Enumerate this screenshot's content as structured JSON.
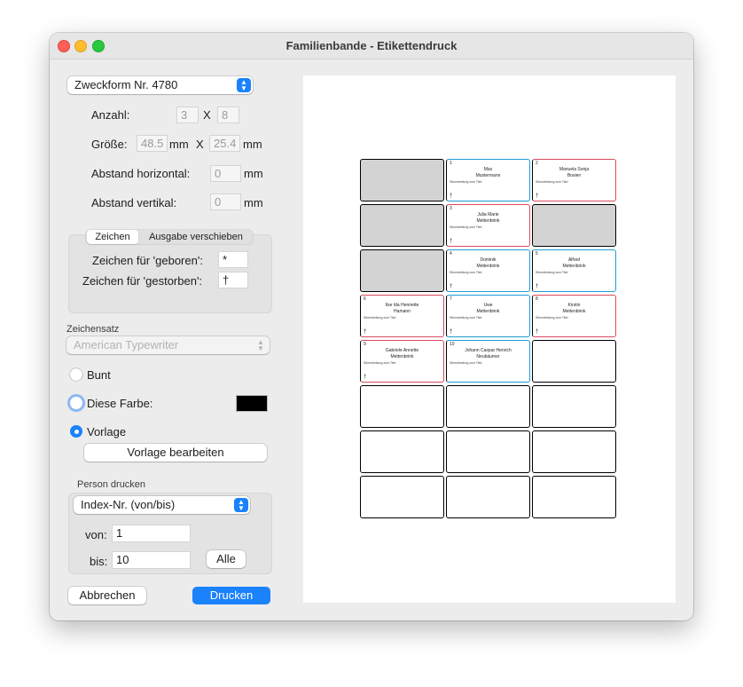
{
  "window": {
    "title": "Familienbande - Etikettendruck"
  },
  "format": {
    "selected": "Zweckform Nr. 4780"
  },
  "anzahl": {
    "label": "Anzahl:",
    "cols": "3",
    "x": "X",
    "rows": "8"
  },
  "groesse": {
    "label": "Größe:",
    "width": "48.5",
    "unit1": "mm",
    "x": "X",
    "height": "25.4",
    "unit2": "mm"
  },
  "abstand_h": {
    "label": "Abstand horizontal:",
    "value": "0",
    "unit": "mm"
  },
  "abstand_v": {
    "label": "Abstand vertikal:",
    "value": "0",
    "unit": "mm"
  },
  "tabs": {
    "zeichen": "Zeichen",
    "ausgabe": "Ausgabe verschieben"
  },
  "zeichen": {
    "geboren_label": "Zeichen für 'geboren':",
    "geboren_value": "*",
    "gestorben_label": "Zeichen für 'gestorben':",
    "gestorben_value": "†"
  },
  "zeichensatz": {
    "label": "Zeichensatz",
    "value": "American Typewriter"
  },
  "color": {
    "bunt": "Bunt",
    "diese_farbe": "Diese Farbe:",
    "vorlage": "Vorlage",
    "swatch": "#000000"
  },
  "vorlage_button": "Vorlage bearbeiten",
  "person": {
    "label": "Person drucken",
    "mode": "Index-Nr. (von/bis)",
    "von_label": "von:",
    "von_value": "1",
    "bis_label": "bis:",
    "bis_value": "10",
    "alle": "Alle"
  },
  "buttons": {
    "cancel": "Abbrechen",
    "print": "Drucken"
  },
  "labels": [
    {
      "type": "gray"
    },
    {
      "type": "male",
      "idx": "1",
      "line1": "Max",
      "line2": "Mustermann",
      "rel": "Stimmbeitung zum Titel",
      "mark": "†"
    },
    {
      "type": "female",
      "idx": "2",
      "line1": "Manuela Sonja",
      "line2": "Bosien",
      "rel": "Stimmbeitung zum Titel",
      "mark": "†"
    },
    {
      "type": "gray"
    },
    {
      "type": "female",
      "idx": "3",
      "line1": "Julia Marie",
      "line2": "Mettenbrink",
      "rel": "Stimmbeitung zum Titel",
      "mark": "†"
    },
    {
      "type": "gray"
    },
    {
      "type": "gray"
    },
    {
      "type": "male",
      "idx": "4",
      "line1": "Dominik",
      "line2": "Mettenbrink",
      "rel": "Stimmbeitung zum Titel",
      "mark": "†"
    },
    {
      "type": "male",
      "idx": "5",
      "line1": "Alfred",
      "line2": "Mettenbrink",
      "rel": "Stimmbeitung zum Titel",
      "mark": "†"
    },
    {
      "type": "female",
      "idx": "6",
      "line1": "Ilse Ida Henriette",
      "line2": "Hamann",
      "rel": "Stimmbeitung zum Titel",
      "mark": "†"
    },
    {
      "type": "male",
      "idx": "7",
      "line1": "Uwe",
      "line2": "Mettenbrink",
      "rel": "Stimmbeitung zum Titel",
      "mark": "†"
    },
    {
      "type": "female",
      "idx": "8",
      "line1": "Kirstin",
      "line2": "Mettenbrink",
      "rel": "Stimmbeitung zum Titel",
      "mark": "†"
    },
    {
      "type": "female",
      "idx": "9",
      "line1": "Gabriele Annette",
      "line2": "Mettenbrink",
      "rel": "Stimmbeitung zum Titel",
      "mark": "†"
    },
    {
      "type": "male",
      "idx": "10",
      "line1": "Johann Caspar Henrich",
      "line2": "Neubäumer",
      "rel": "Stimmbeitung zum Titel",
      "mark": ""
    },
    {
      "type": "empty"
    },
    {
      "type": "empty"
    },
    {
      "type": "empty"
    },
    {
      "type": "empty"
    },
    {
      "type": "empty"
    },
    {
      "type": "empty"
    },
    {
      "type": "empty"
    },
    {
      "type": "empty"
    },
    {
      "type": "empty"
    },
    {
      "type": "empty"
    }
  ]
}
